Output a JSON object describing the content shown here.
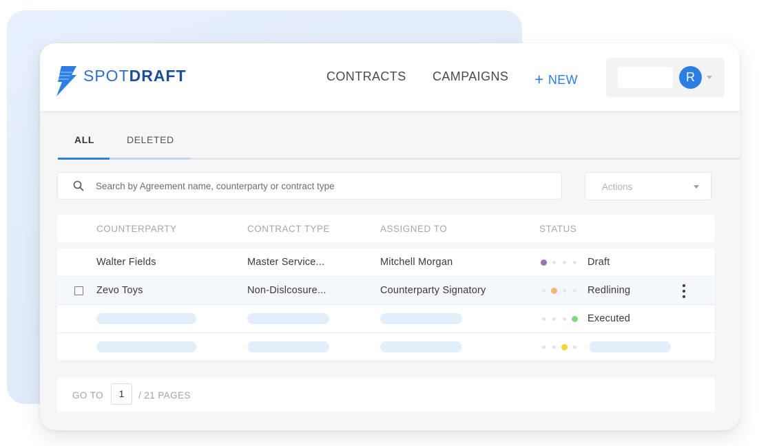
{
  "brand": {
    "name_light": "SPOT",
    "name_bold": "DRAFT",
    "accent": "#2d7ee3",
    "dark_accent": "#1c4d96"
  },
  "header": {
    "nav": [
      {
        "label": "CONTRACTS"
      },
      {
        "label": "CAMPAIGNS"
      }
    ],
    "new_button": {
      "icon": "+",
      "label": "NEW"
    },
    "user": {
      "avatar_initial": "R"
    }
  },
  "tabs": [
    {
      "label": "ALL",
      "active": true
    },
    {
      "label": "DELETED",
      "active": false
    }
  ],
  "search": {
    "placeholder": "Search by Agreement name, counterparty or contract type",
    "icon": "search-icon"
  },
  "actions": {
    "label": "Actions"
  },
  "table": {
    "columns": [
      "COUNTERPARTY",
      "CONTRACT TYPE",
      "ASSIGNED TO",
      "STATUS"
    ],
    "rows": [
      {
        "counterparty": "Walter Fields",
        "contract_type": "Master Service...",
        "assigned_to": "Mitchell Morgan",
        "status": "Draft",
        "status_step": 1,
        "status_color": "#9b72b0"
      },
      {
        "counterparty": "Zevo Toys",
        "contract_type": "Non-Dislcosure...",
        "assigned_to": "Counterparty Signatory",
        "status": "Redlining",
        "status_step": 2,
        "status_color": "#f0b877"
      },
      {
        "counterparty": "",
        "contract_type": "",
        "assigned_to": "",
        "status": "Executed",
        "status_step": 4,
        "status_color": "#7ed87e"
      },
      {
        "counterparty": "",
        "contract_type": "",
        "assigned_to": "",
        "status": "",
        "status_step": 3,
        "status_color": "#f4d338"
      }
    ]
  },
  "pagination": {
    "goto_label": "GO TO",
    "current_page": "1",
    "total_label": "/ 21 PAGES"
  }
}
